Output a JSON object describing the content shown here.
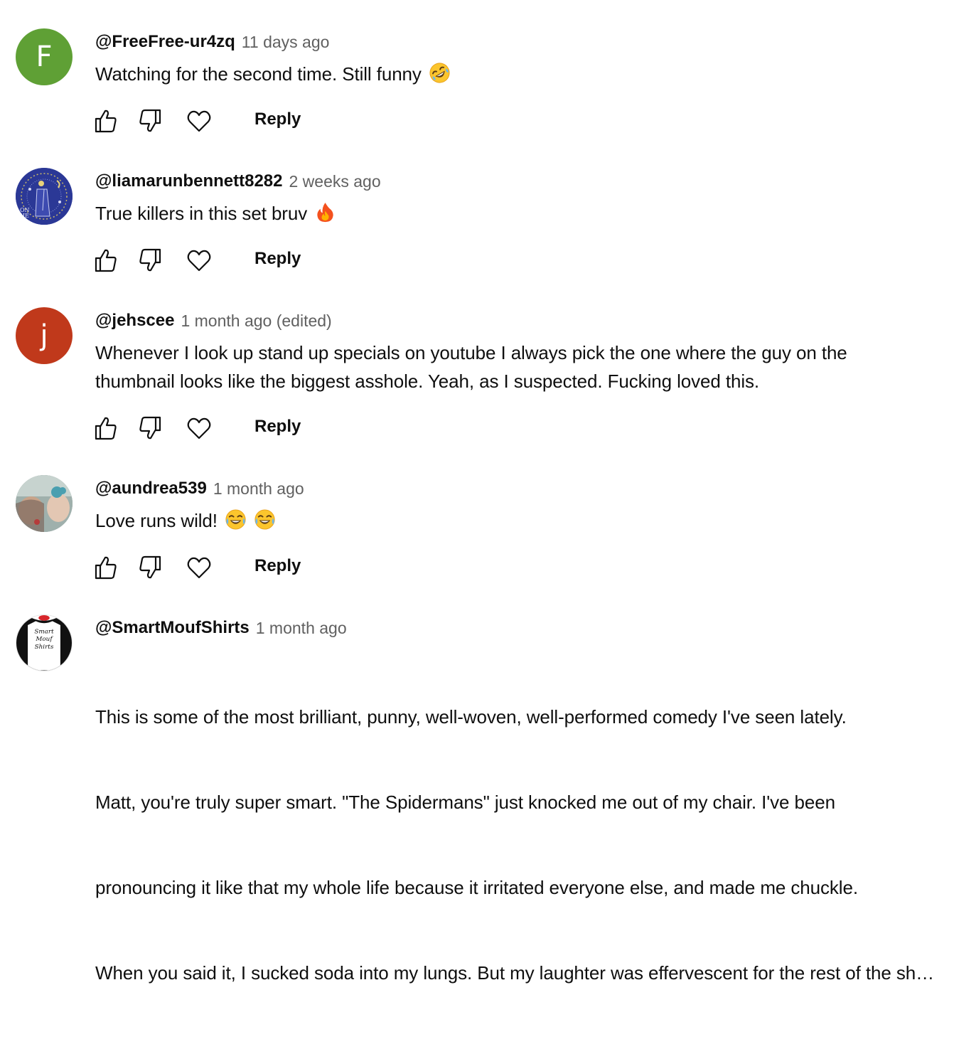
{
  "comments": [
    {
      "author": "@FreeFree-ur4zq",
      "time": "11 days ago",
      "text": "Watching for the second time. Still funny",
      "emojis": [
        "rofl-emoji"
      ],
      "avatar_letter": "F",
      "avatar_color": "#5fa035"
    },
    {
      "author": "@liamarunbennett8282",
      "time": "2 weeks ago",
      "text": "True killers in this set bruv",
      "emojis": [
        "fire-emoji"
      ],
      "avatar_color": "#2d3a9a"
    },
    {
      "author": "@jehscee",
      "time": "1 month ago (edited)",
      "text": "Whenever I look up stand up specials on youtube I always pick the one where the guy on the thumbnail looks like the biggest asshole. Yeah, as I suspected. Fucking loved this.",
      "avatar_letter": "j",
      "avatar_color": "#c0391b"
    },
    {
      "author": "@aundrea539",
      "time": "1 month ago",
      "text": "Love runs wild!",
      "emojis": [
        "tears-of-joy-emoji",
        "tears-of-joy-emoji"
      ],
      "avatar_color": "#8a9a96"
    },
    {
      "author": "@SmartMoufShirts",
      "time": "1 month ago",
      "lines": [
        "This is some of the most brilliant, punny, well-woven, well-performed comedy I've seen lately.",
        "Matt, you're truly super smart.  \"The Spidermans\" just knocked me out of my chair.  I've been",
        "pronouncing it like that my whole life because it irritated everyone else, and made me chuckle.",
        "When you said it, I sucked soda into my lungs.  But my laughter was effervescent for the rest of the show."
      ],
      "avatar_text": [
        "Smart",
        "Mouf",
        "Shirts"
      ]
    }
  ],
  "reply_label": "Reply"
}
